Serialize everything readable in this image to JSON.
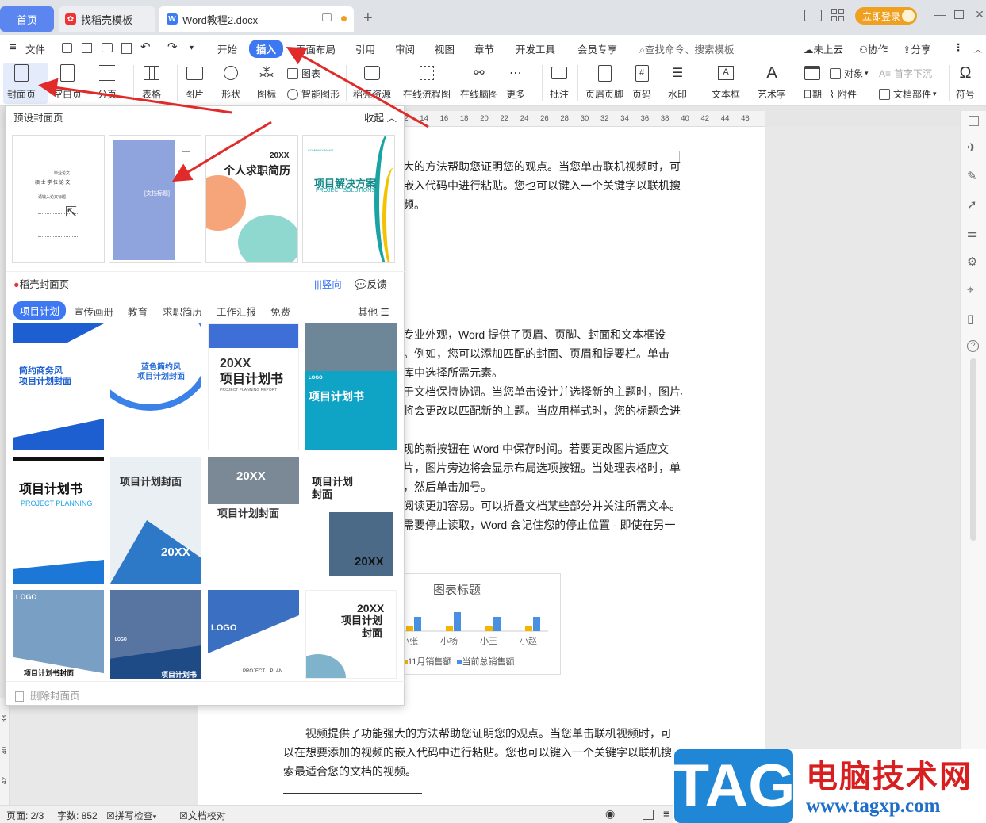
{
  "tabs": {
    "home": "首页",
    "template": "找稻壳模板",
    "doc": "Word教程2.docx"
  },
  "login": "立即登录",
  "menu": {
    "file": "文件",
    "items": [
      "开始",
      "插入",
      "页面布局",
      "引用",
      "审阅",
      "视图",
      "章节",
      "开发工具",
      "会员专享"
    ],
    "search": "查找命令、搜索模板",
    "cloud": "未上云",
    "collab": "协作",
    "share": "分享"
  },
  "ribbon": {
    "cover": "封面页",
    "blank": "空白页",
    "pagebreak": "分页",
    "table": "表格",
    "picture": "图片",
    "shape": "形状",
    "icon": "图标",
    "chart": "图表",
    "smart": "智能图形",
    "resource": "稻壳资源",
    "flow": "在线流程图",
    "mind": "在线脑图",
    "more": "更多",
    "comment": "批注",
    "headerfooter": "页眉页脚",
    "pagenum": "页码",
    "watermark": "水印",
    "textbox": "文本框",
    "arttext": "艺术字",
    "date": "日期",
    "object": "对象",
    "attach": "附件",
    "dropcap": "首字下沉",
    "docpart": "文档部件",
    "symbol": "符号"
  },
  "ruler": [
    "12",
    "14",
    "16",
    "18",
    "20",
    "22",
    "24",
    "26",
    "28",
    "30",
    "32",
    "34",
    "36",
    "38",
    "40",
    "42",
    "44",
    "46"
  ],
  "panel": {
    "preset": "预设封面页",
    "collapse": "收起",
    "covers": [
      {
        "lines": [
          "毕业论文",
          "硕 士 学 位 论 文",
          "请输入论文标题"
        ]
      },
      {
        "label": "[文档标题]"
      },
      {
        "year": "20XX",
        "title": "个人求职简历"
      },
      {
        "company": "COMPANY NAME",
        "title": "项目解决方案",
        "sub": "PROJECT SOLUTIONS"
      }
    ],
    "daoke": "稻壳封面页",
    "vertical": "竖向",
    "feedback": "反馈",
    "categories": [
      "项目计划",
      "宣传画册",
      "教育",
      "求职简历",
      "工作汇报",
      "免费"
    ],
    "other": "其他",
    "templates": [
      {
        "title": "简约商务风\n项目计划封面"
      },
      {
        "title": "蓝色简约风\n项目计划封面"
      },
      {
        "year": "20XX",
        "title": "项目计划书",
        "sub": "PROJECT PLANNING REPORT"
      },
      {
        "logo": "LOGO",
        "title": "项目计划书"
      },
      {
        "title": "项目计划书",
        "sub": "PROJECT PLANNING"
      },
      {
        "title": "项目计划封面",
        "year": "20XX"
      },
      {
        "year": "20XX",
        "title": "项目计划封面"
      },
      {
        "title": "项目计划\n封面",
        "year": "20XX"
      },
      {
        "logo": "LOGO",
        "title": "项目计划书封面"
      },
      {
        "logo": "LOGO",
        "title": "项目计划书"
      },
      {
        "logo": "LOGO",
        "sub": "PROJECT    PLAN"
      },
      {
        "year": "20XX",
        "title": "项目计划\n封面"
      }
    ],
    "delete": "删除封面页"
  },
  "doc": {
    "p1": [
      "大的方法帮助您证明您的观点。当您单击联机视频时，可",
      "嵌入代码中进行粘贴。您也可以键入一个关键字以联机搜",
      "频。"
    ],
    "p2": [
      "专业外观，Word 提供了页眉、页脚、封面和文本框设",
      "。例如，您可以添加匹配的封面、页眉和提要栏。单击",
      "库中选择所需元素。",
      "于文档保持协调。当您单击设计并选择新的主题时，图片、",
      "将会更改以匹配新的主题。当应用样式时，您的标题会进"
    ],
    "p3": [
      "现的新按钮在 Word 中保存时间。若要更改图片适应文",
      "片，图片旁边将会显示布局选项按钮。当处理表格时，单",
      "，然后单击加号。",
      "阅读更加容易。可以折叠文档某些部分并关注所需文本。",
      "需要停止读取，Word 会记住您的停止位置 - 即使在另一"
    ],
    "p4": [
      "视频提供了功能强大的方法帮助您证明您的观点。当您单击联机视频时，可",
      "以在想要添加的视频的嵌入代码中进行粘贴。您也可以键入一个关键字以联机搜",
      "索最适合您的文档的视频。"
    ]
  },
  "chart": {
    "title": "图表标题",
    "categories": [
      "小张",
      "小杨",
      "小王",
      "小赵"
    ],
    "series": [
      {
        "name": "11月销售额",
        "color": "#f5b400",
        "values": [
          1,
          1,
          1,
          1
        ]
      },
      {
        "name": "当前总销售额",
        "color": "#4a90e2",
        "values": [
          3,
          4,
          3,
          3
        ]
      }
    ]
  },
  "status": {
    "page": "页面: 2/3",
    "words": "字数: 852",
    "spell": "拼写检查",
    "proof": "文档校对"
  },
  "watermark": {
    "tag": "TAG",
    "cn": "电脑技术网",
    "url": "www.tagxp.com"
  }
}
